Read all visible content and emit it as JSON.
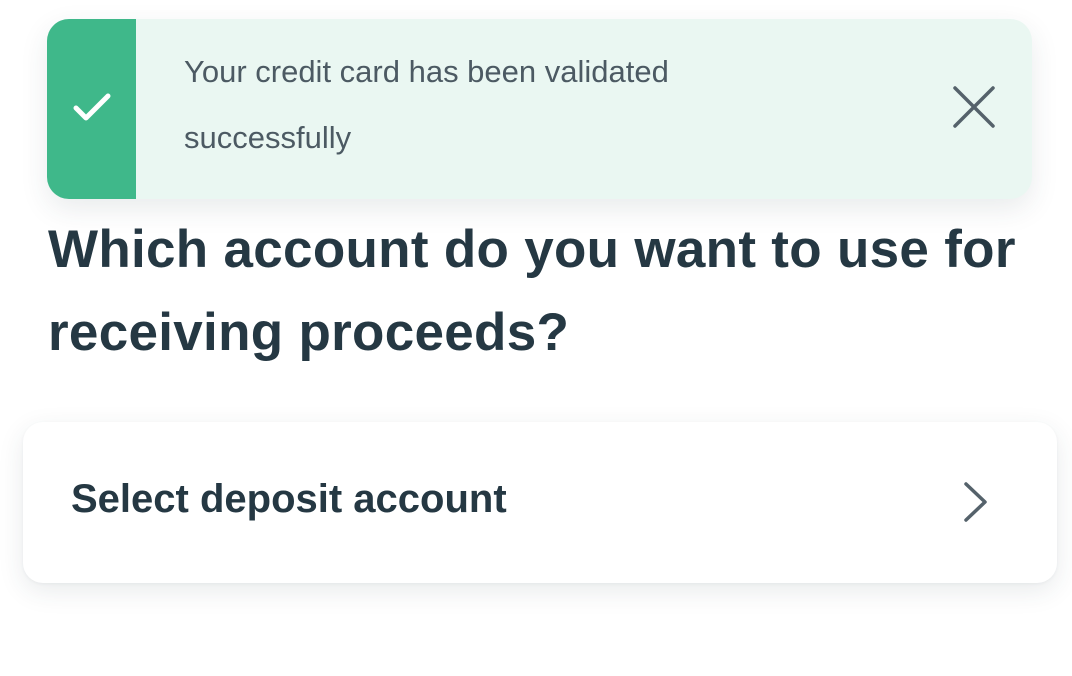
{
  "toast": {
    "message": "Your credit card has been validated successfully",
    "status_icon": "checkmark-icon",
    "close_icon": "close-icon",
    "accent_color": "#3fb88a",
    "background_color": "#eaf7f2"
  },
  "main": {
    "heading": "Which account do you want to use for receiving proceeds?",
    "deposit_selector": {
      "label": "Select deposit account",
      "icon": "chevron-right-icon"
    }
  }
}
